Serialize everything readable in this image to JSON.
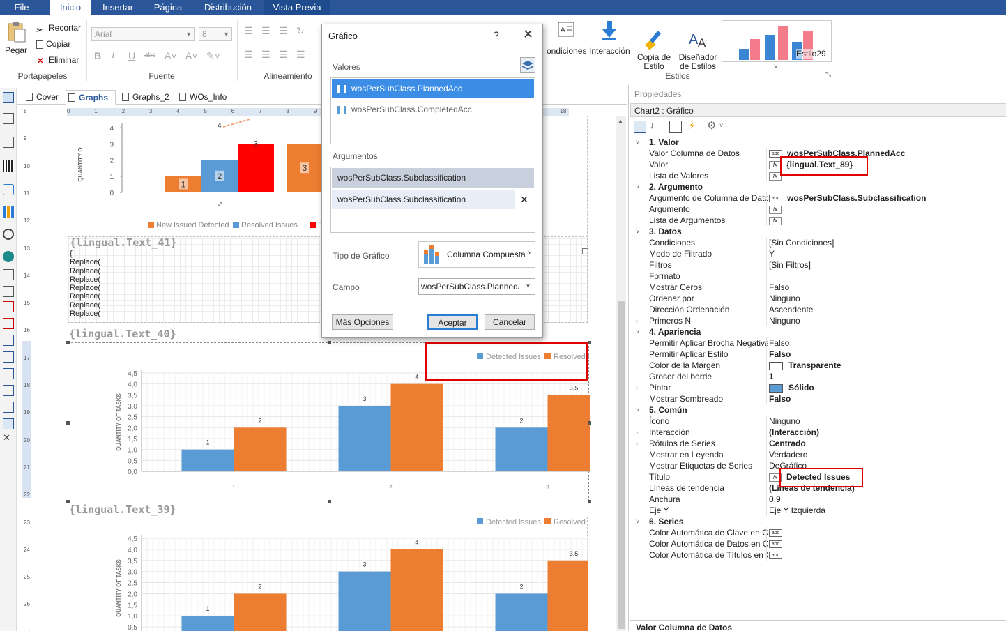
{
  "ribbon_tabs": [
    "File",
    "Inicio",
    "Insertar",
    "Página",
    "Distribución",
    "Vista Previa"
  ],
  "clipboard": {
    "paste": "Pegar",
    "cut": "Recortar",
    "copy": "Copiar",
    "delete": "Eliminar",
    "group": "Portapapeles"
  },
  "font": {
    "family": "Arial",
    "size": "8",
    "group": "Fuente",
    "bold": "B",
    "italic": "I",
    "underline": "U",
    "strike": "abc"
  },
  "alignment": {
    "group": "Alineamiento"
  },
  "styles": {
    "conditions": "ondiciones",
    "interaction": "Interacción",
    "copy_style": "Copia de\nEstilo",
    "designer": "Diseñador\nde Estilos",
    "preview_name": "Estilo29",
    "group": "Estilos"
  },
  "doc_tabs": [
    "Cover",
    "Graphs",
    "Graphs_2",
    "WOs_Info"
  ],
  "ruler_h": [
    "0",
    "1",
    "2",
    "3",
    "4",
    "5",
    "6",
    "7",
    "8",
    "9",
    "10",
    "11",
    "12",
    "13",
    "14",
    "15",
    "16",
    "17",
    "18"
  ],
  "ruler_v": [
    "8",
    "9",
    "10",
    "11",
    "12",
    "13",
    "14",
    "15",
    "16",
    "17",
    "18",
    "19",
    "20",
    "21",
    "22",
    "23",
    "24",
    "25",
    "26",
    "27"
  ],
  "bands": {
    "text41": "{lingual.Text_41}",
    "text40": "{lingual.Text_40}",
    "text39": "{lingual.Text_39}",
    "replace_lines": [
      "{",
      "Replace(",
      "Replace(",
      "Replace(",
      "Replace(",
      "Replace(",
      "Replace(",
      "Replace("
    ]
  },
  "chart_data": [
    {
      "type": "bar",
      "ylabel": "QUANTITY O",
      "categories": [
        "1"
      ],
      "ylim": [
        0,
        4
      ],
      "yticks": [
        "0",
        "1",
        "2",
        "3",
        "4"
      ],
      "series": [
        {
          "name": "New Issued Detected",
          "color": "#ed7d31",
          "bars": [
            {
              "x": 236,
              "y": 1,
              "label": "1"
            },
            {
              "x": 410,
              "y": 3,
              "label": "3"
            }
          ]
        },
        {
          "name": "Resolved Issues",
          "color": "#5b9bd5",
          "bars": [
            {
              "x": 288,
              "y": 2,
              "label": "2"
            }
          ]
        },
        {
          "name": "Diff",
          "color": "#ff0000",
          "bars": [
            {
              "x": 340,
              "y": 3,
              "label": "3"
            }
          ]
        }
      ],
      "legend": [
        "New Issued Detected",
        "Resolved Issues",
        "Diff"
      ],
      "annotation": "4"
    },
    {
      "type": "bar",
      "ylabel": "QUANTITY OF TASKS",
      "categories": [
        "1",
        "2",
        "3"
      ],
      "ylim": [
        0,
        4.5
      ],
      "yticks": [
        "0,0",
        "0,5",
        "1,0",
        "1,5",
        "2,0",
        "2,5",
        "3,0",
        "3,5",
        "4,0",
        "4,5"
      ],
      "series": [
        {
          "name": "Detected Issues",
          "color": "#5b9bd5",
          "values": [
            1,
            3,
            2
          ],
          "labels": [
            "1",
            "3",
            "2"
          ]
        },
        {
          "name": "Resolved Issues",
          "color": "#ed7d31",
          "values": [
            2,
            4,
            3.5
          ],
          "labels": [
            "2",
            "4",
            "3,5"
          ]
        }
      ],
      "legend": "top-right"
    },
    {
      "type": "bar",
      "ylabel": "QUANTITY OF TASKS",
      "categories": [
        "1",
        "2",
        "3"
      ],
      "ylim": [
        0,
        4.5
      ],
      "yticks": [
        "0,5",
        "1,0",
        "1,5",
        "2,0",
        "2,5",
        "3,0",
        "3,5",
        "4,0",
        "4,5"
      ],
      "series": [
        {
          "name": "Detected Issues",
          "color": "#5b9bd5",
          "values": [
            1,
            3,
            2
          ],
          "labels": [
            "1",
            "3",
            "2"
          ]
        },
        {
          "name": "Resolved Issues",
          "color": "#ed7d31",
          "values": [
            2,
            4,
            3.5
          ],
          "labels": [
            "2",
            "4",
            "3,5"
          ]
        }
      ],
      "legend": "top-right"
    }
  ],
  "dialog": {
    "title": "Gráfico",
    "help": "?",
    "close": "✕",
    "values_label": "Valores",
    "values": [
      "wosPerSubClass.PlannedAcc",
      "wosPerSubClass.CompletedAcc"
    ],
    "arguments_label": "Argumentos",
    "arguments": [
      "wosPerSubClass.Subclassification",
      "wosPerSubClass.Subclassification"
    ],
    "chart_type_label": "Tipo de Gráfico",
    "chart_type": "Columna Compuesta",
    "field_label": "Campo",
    "field": "wosPerSubClass.PlannedAcc",
    "more": "Más Opciones",
    "ok": "Aceptar",
    "cancel": "Cancelar"
  },
  "properties": {
    "title": "Propiedades",
    "object": "Chart2 : Gráfico",
    "footer": "Valor Columna de Datos",
    "rows": [
      {
        "t": "cat",
        "n": "1. Valor"
      },
      {
        "t": "p",
        "n": "Valor Columna de Datos",
        "v": "wosPerSubClass.PlannedAcc",
        "ic": "abc",
        "b": true
      },
      {
        "t": "p",
        "n": "Valor",
        "v": "{lingual.Text_89}",
        "ic": "fx",
        "b": true
      },
      {
        "t": "p",
        "n": "Lista de Valores",
        "v": "",
        "ic": "fx"
      },
      {
        "t": "cat",
        "n": "2. Argumento"
      },
      {
        "t": "p",
        "n": "Argumento de Columna de Datos",
        "v": "wosPerSubClass.Subclassification",
        "ic": "abc",
        "b": true
      },
      {
        "t": "p",
        "n": "Argumento",
        "v": "",
        "ic": "fx"
      },
      {
        "t": "p",
        "n": "Lista de Argumentos",
        "v": "",
        "ic": "fx"
      },
      {
        "t": "cat",
        "n": "3. Datos"
      },
      {
        "t": "p",
        "n": "Condiciones",
        "v": "[Sin Condiciones]"
      },
      {
        "t": "p",
        "n": "Modo de Filtrado",
        "v": "Y"
      },
      {
        "t": "p",
        "n": "Filtros",
        "v": "[Sin Filtros]"
      },
      {
        "t": "p",
        "n": "Formato",
        "v": ""
      },
      {
        "t": "p",
        "n": "Mostrar Ceros",
        "v": "Falso"
      },
      {
        "t": "p",
        "n": "Ordenar por",
        "v": "Ninguno"
      },
      {
        "t": "p",
        "n": "Dirección Ordenación",
        "v": "Ascendente"
      },
      {
        "t": "p",
        "n": "Primeros N",
        "v": "Ninguno",
        "e": true
      },
      {
        "t": "cat",
        "n": "4. Apariencia"
      },
      {
        "t": "p",
        "n": "Permitir Aplicar Brocha Negativa",
        "v": "Falso"
      },
      {
        "t": "p",
        "n": "Permitir Aplicar Estilo",
        "v": "Falso",
        "b": true
      },
      {
        "t": "p",
        "n": "Color de la Margen",
        "v": "Transparente",
        "b": true,
        "sw": "#ffffff"
      },
      {
        "t": "p",
        "n": "Grosor del borde",
        "v": "1",
        "b": true
      },
      {
        "t": "p",
        "n": "Pintar",
        "v": "Sólido",
        "b": true,
        "sw": "#5b9bd5",
        "e": true
      },
      {
        "t": "p",
        "n": "Mostrar Sombreado",
        "v": "Falso",
        "b": true
      },
      {
        "t": "cat",
        "n": "5. Común"
      },
      {
        "t": "p",
        "n": "Ícono",
        "v": "Ninguno"
      },
      {
        "t": "p",
        "n": "Interacción",
        "v": "(Interacción)",
        "b": true,
        "e": true
      },
      {
        "t": "p",
        "n": "Rótulos de Series",
        "v": "Centrado",
        "b": true,
        "e": true
      },
      {
        "t": "p",
        "n": "Mostrar en Leyenda",
        "v": "Verdadero"
      },
      {
        "t": "p",
        "n": "Mostrar Etiquetas de Series",
        "v": "DeGráfico"
      },
      {
        "t": "p",
        "n": "Título",
        "v": "Detected Issues",
        "ic": "fx",
        "b": true
      },
      {
        "t": "p",
        "n": "Líneas de tendencia",
        "v": "(Líneas de tendencia)",
        "b": true
      },
      {
        "t": "p",
        "n": "Anchura",
        "v": "0,9"
      },
      {
        "t": "p",
        "n": "Eje Y",
        "v": "Eje Y Izquierda"
      },
      {
        "t": "cat",
        "n": "6. Series"
      },
      {
        "t": "p",
        "n": "Color Automática de Clave en Colun",
        "v": "",
        "ic": "abc"
      },
      {
        "t": "p",
        "n": "Color Automática de Datos en Colur",
        "v": "",
        "ic": "abc"
      },
      {
        "t": "p",
        "n": "Color Automática de Títulos en Colu",
        "v": "",
        "ic": "abc"
      }
    ]
  },
  "colors": {
    "accent": "#2b579a",
    "blue": "#5b9bd5",
    "orange": "#ed7d31",
    "red": "#ff0000",
    "highlight": "#e00000"
  }
}
